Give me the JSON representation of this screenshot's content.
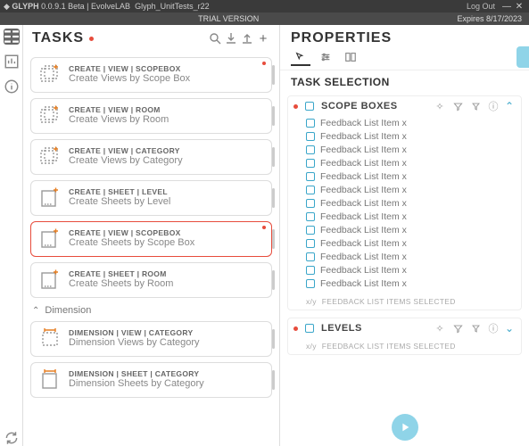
{
  "app": {
    "name": "GLYPH",
    "version": "0.0.9.1 Beta",
    "vendor": "EvolveLAB",
    "doc": "Glyph_UnitTests_r22",
    "logout": "Log Out",
    "trial": "TRIAL VERSION",
    "expires": "Expires 8/17/2023"
  },
  "tasks": {
    "title": "TASKS",
    "groups": [
      {
        "name": "Dimension"
      }
    ],
    "cards": [
      {
        "crumb": "CREATE  |  VIEW  |  SCOPEBOX",
        "desc": "Create Views by Scope Box",
        "dot": true,
        "icon": "view"
      },
      {
        "crumb": "CREATE  |  VIEW  |  ROOM",
        "desc": "Create Views by Room",
        "dot": false,
        "icon": "view"
      },
      {
        "crumb": "CREATE  |  VIEW  |  CATEGORY",
        "desc": "Create Views by Category",
        "dot": false,
        "icon": "view"
      },
      {
        "crumb": "CREATE  |  SHEET  |  LEVEL",
        "desc": "Create Sheets by Level",
        "dot": false,
        "icon": "sheet"
      },
      {
        "crumb": "CREATE  |  VIEW  |  SCOPEBOX",
        "desc": "Create Sheets by Scope Box",
        "dot": true,
        "icon": "sheet",
        "selected": true
      },
      {
        "crumb": "CREATE  |  SHEET  |  ROOM",
        "desc": "Create Sheets by Room",
        "dot": false,
        "icon": "sheet"
      },
      {
        "crumb": "DIMENSION  |  VIEW  |  CATEGORY",
        "desc": "Dimension Views by Category",
        "dot": false,
        "icon": "dimv"
      },
      {
        "crumb": "DIMENSION  |  SHEET  |  CATEGORY",
        "desc": "Dimension Sheets by Category",
        "dot": false,
        "icon": "dims"
      }
    ]
  },
  "props": {
    "title": "PROPERTIES",
    "section": "TASK SELECTION",
    "panels": {
      "scope": {
        "title": "SCOPE BOXES",
        "summary": "FEEDBACK LIST ITEMS SELECTED",
        "xy": "x/y",
        "items": [
          "Feedback List Item x",
          "Feedback List Item x",
          "Feedback List Item x",
          "Feedback List Item x",
          "Feedback List Item x",
          "Feedback List Item x",
          "Feedback List Item x",
          "Feedback List Item x",
          "Feedback List Item x",
          "Feedback List Item x",
          "Feedback List Item x",
          "Feedback List Item x",
          "Feedback List Item x"
        ]
      },
      "levels": {
        "title": "LEVELS",
        "summary": "FEEDBACK LIST ITEMS SELECTED",
        "xy": "x/y"
      }
    }
  }
}
